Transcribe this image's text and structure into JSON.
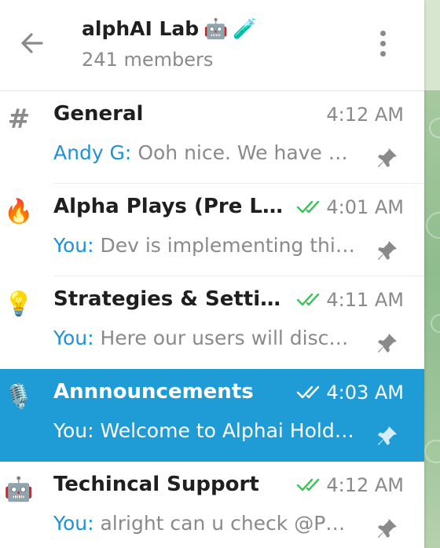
{
  "header": {
    "title": "alphAI Lab",
    "title_emojis": [
      "🤖",
      "🧪"
    ],
    "members": "241 members",
    "back_icon": "arrow-left-icon",
    "menu_icon": "more-vertical-icon"
  },
  "colors": {
    "accent": "#1f9bd6",
    "sender_blue": "#1f92d6",
    "check_green": "#3ec25a",
    "muted_gray": "#8a8a8a"
  },
  "topics": [
    {
      "icon": "#",
      "icon_name": "hash-icon",
      "title": "General",
      "time": "4:12 AM",
      "read_checks": false,
      "sender": "Andy G:",
      "preview": "Ooh nice. We have a lot of cool things coming",
      "pinned": true,
      "selected": false
    },
    {
      "icon": "🔥",
      "icon_name": "fire-icon",
      "title": "Alpha Plays (Pre LP, Pre Trending)",
      "time": "4:01 AM",
      "read_checks": true,
      "sender": "You:",
      "preview": "Dev is implementing this feature right now",
      "pinned": true,
      "selected": false
    },
    {
      "icon": "💡",
      "icon_name": "lightbulb-icon",
      "title": "Strategies & Settings",
      "time": "4:11 AM",
      "read_checks": true,
      "sender": "You:",
      "preview": "Here our users will discuss their strategies",
      "pinned": true,
      "selected": false
    },
    {
      "icon": "🎙️",
      "icon_name": "microphone-icon",
      "title": "Annnouncements",
      "time": "4:03 AM",
      "read_checks": true,
      "sender": "You:",
      "preview": "Welcome to Alphai Holders Chat",
      "pinned": true,
      "selected": true
    },
    {
      "icon": "🤖",
      "icon_name": "robot-icon",
      "title": "Techincal Support",
      "time": "4:12 AM",
      "read_checks": true,
      "sender": "You:",
      "preview": "alright can u check @Phoenix",
      "pinned": true,
      "selected": false
    }
  ]
}
